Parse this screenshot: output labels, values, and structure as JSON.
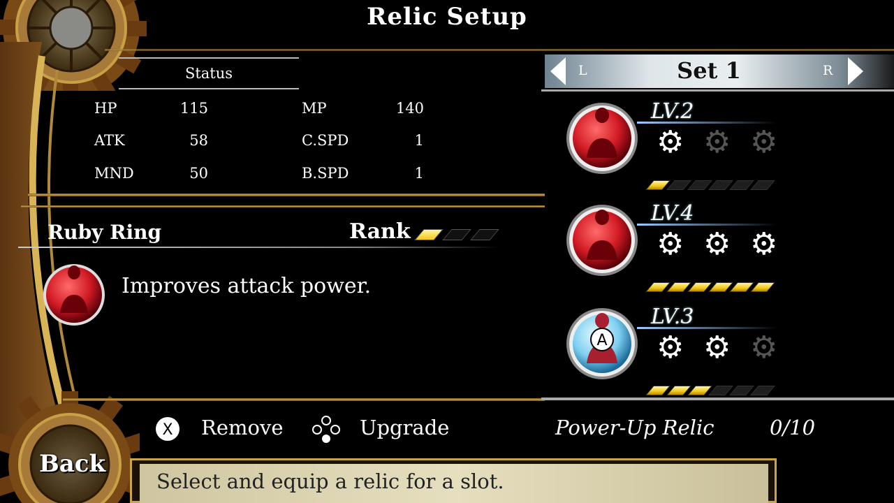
{
  "title": "Relic Setup",
  "status": {
    "header": "Status",
    "rows": [
      {
        "label": "HP",
        "value": "115",
        "label2": "MP",
        "value2": "140"
      },
      {
        "label": "ATK",
        "value": "58",
        "label2": "C.SPD",
        "value2": "1"
      },
      {
        "label": "MND",
        "value": "50",
        "label2": "B.SPD",
        "value2": "1"
      }
    ]
  },
  "relic": {
    "name": "Ruby Ring",
    "rank_label": "Rank",
    "rank_filled": 1,
    "rank_total": 3,
    "description": "Improves attack power.",
    "icon": "red-silhouette-icon"
  },
  "set": {
    "label": "Set 1",
    "left": "L",
    "right": "R"
  },
  "slots": [
    {
      "level": "LV.2",
      "cogs_active": 1,
      "bar_filled": 1,
      "bar_total": 6,
      "icon": "red-silhouette-icon"
    },
    {
      "level": "LV.4",
      "cogs_active": 3,
      "bar_filled": 6,
      "bar_total": 6,
      "icon": "red-silhouette-icon"
    },
    {
      "level": "LV.3",
      "cogs_active": 2,
      "bar_filled": 3,
      "bar_total": 6,
      "icon": "blue-silhouette-icon",
      "badge": "A"
    }
  ],
  "hints": {
    "remove_button": "X",
    "remove": "Remove",
    "upgrade": "Upgrade",
    "power_up_label": "Power-Up Relic",
    "power_up_count": "0/10"
  },
  "footer": {
    "message": "Select and equip a relic for a slot.",
    "back": "Back"
  },
  "colors": {
    "gold": "#caa24a",
    "red_orb": "#d11a24",
    "blue_orb": "#7fd0f0",
    "bar_yellow": "#f2c81a"
  }
}
